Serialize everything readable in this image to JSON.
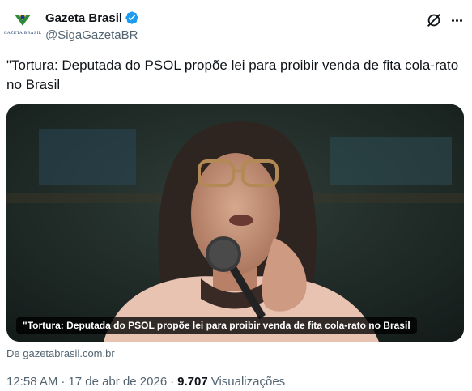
{
  "author": {
    "display_name": "Gazeta Brasil",
    "handle": "@SigaGazetaBR",
    "avatar_text": "GAZETA BRASIL",
    "verified_color": "#1d9bf0"
  },
  "tweet": {
    "text": "\"Tortura: Deputada do PSOL propõe lei para proibir venda de fita cola-rato no Brasil"
  },
  "card": {
    "caption": "\"Tortura: Deputada do PSOL propõe lei para proibir venda de fita cola-rato no Brasil",
    "source": "De gazetabrasil.com.br",
    "image_icon": "person-at-microphone-photo"
  },
  "meta": {
    "time": "12:58 AM",
    "separator": "·",
    "date": "17 de abr de 2026",
    "views_count": "9.707",
    "views_label": "Visualizações"
  },
  "colors": {
    "text_primary": "#0f1419",
    "text_secondary": "#536471",
    "accent": "#1d9bf0"
  }
}
